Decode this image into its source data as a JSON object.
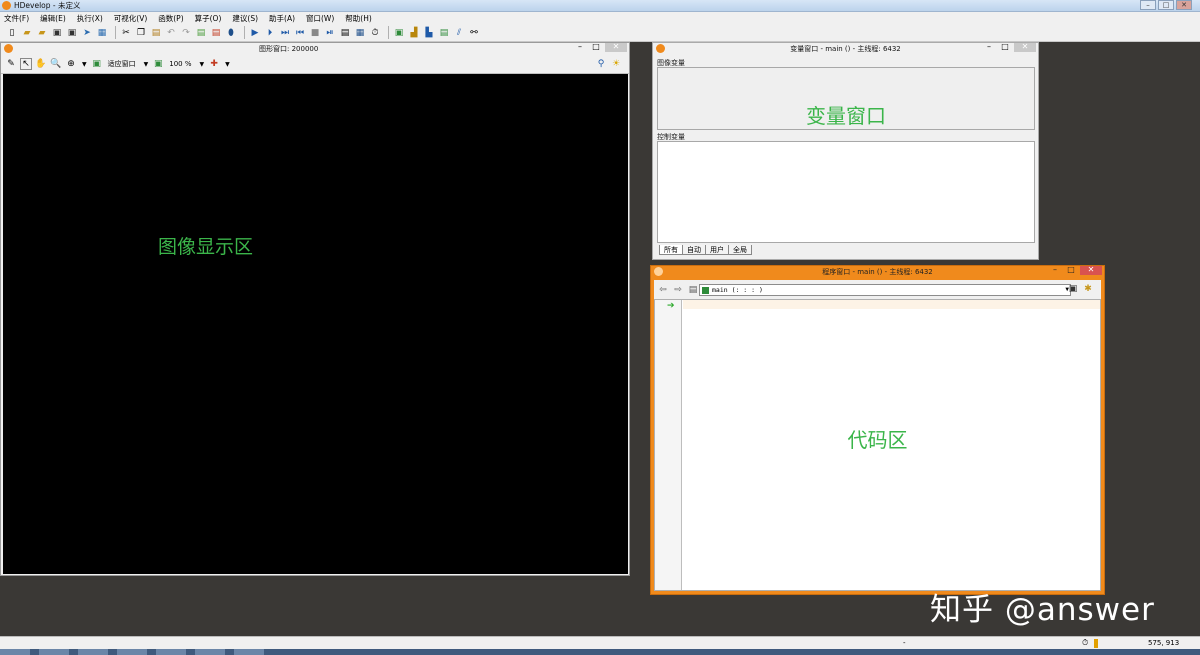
{
  "app": {
    "title": "HDevelop - 未定义"
  },
  "menu": [
    "文件(F)",
    "编辑(E)",
    "执行(X)",
    "可视化(V)",
    "函数(P)",
    "算子(O)",
    "建议(S)",
    "助手(A)",
    "窗口(W)",
    "帮助(H)"
  ],
  "graphics_window": {
    "title": "图形窗口: 200000",
    "zoom_mode_label": "适应窗口",
    "zoom_percent": "100 %",
    "annotation": "图像显示区"
  },
  "variable_window": {
    "title": "变量窗口 - main () - 主线程: 6432",
    "image_vars_label": "图像变量",
    "control_vars_label": "控制变量",
    "annotation": "变量窗口",
    "tabs": [
      "所有",
      "自动",
      "用户",
      "全局"
    ]
  },
  "program_window": {
    "title": "程序窗口 - main () - 主线程: 6432",
    "procedure": "main (: : : )",
    "annotation": "代码区"
  },
  "watermark": "知乎 @answer",
  "status": {
    "dash": "-",
    "coordinates": "575,  913"
  },
  "colors": {
    "accent_orange": "#f08a1c",
    "annotation_green": "#3bb54a",
    "desktop": "#3a3835"
  }
}
